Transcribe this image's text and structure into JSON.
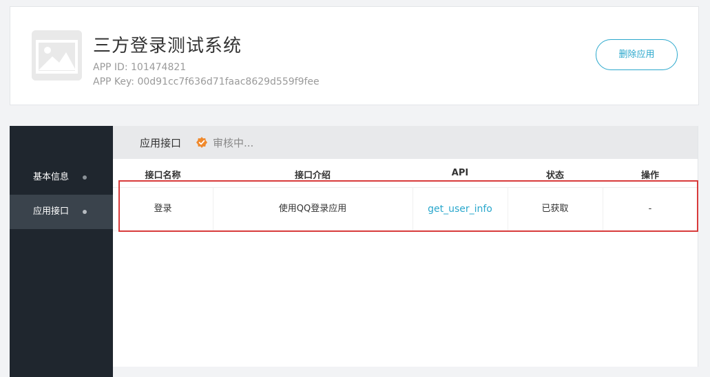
{
  "header": {
    "app_name": "三方登录测试系统",
    "app_id_label": "APP ID:",
    "app_id_value": "101474821",
    "app_key_label": "APP Key:",
    "app_key_value": "00d91cc7f636d71faac8629d559f9fee",
    "delete_button": "删除应用",
    "logo_icon": "image-placeholder-icon"
  },
  "sidebar": {
    "items": [
      {
        "label": "基本信息",
        "active": false
      },
      {
        "label": "应用接口",
        "active": true
      }
    ]
  },
  "main": {
    "tab_title": "应用接口",
    "status_icon": "verified-badge-icon",
    "status_text": "审核中...",
    "table": {
      "columns": [
        "接口名称",
        "接口介绍",
        "API",
        "状态",
        "操作"
      ],
      "rows": [
        {
          "name": "登录",
          "description": "使用QQ登录应用",
          "api": "get_user_info",
          "status": "已获取",
          "action": "-"
        }
      ]
    }
  },
  "colors": {
    "accent": "#29a7cc",
    "sidebar_bg": "#1f262e",
    "sidebar_active": "#3a434c",
    "status_orange": "#f0892c",
    "highlight_red": "#d83a3a"
  }
}
